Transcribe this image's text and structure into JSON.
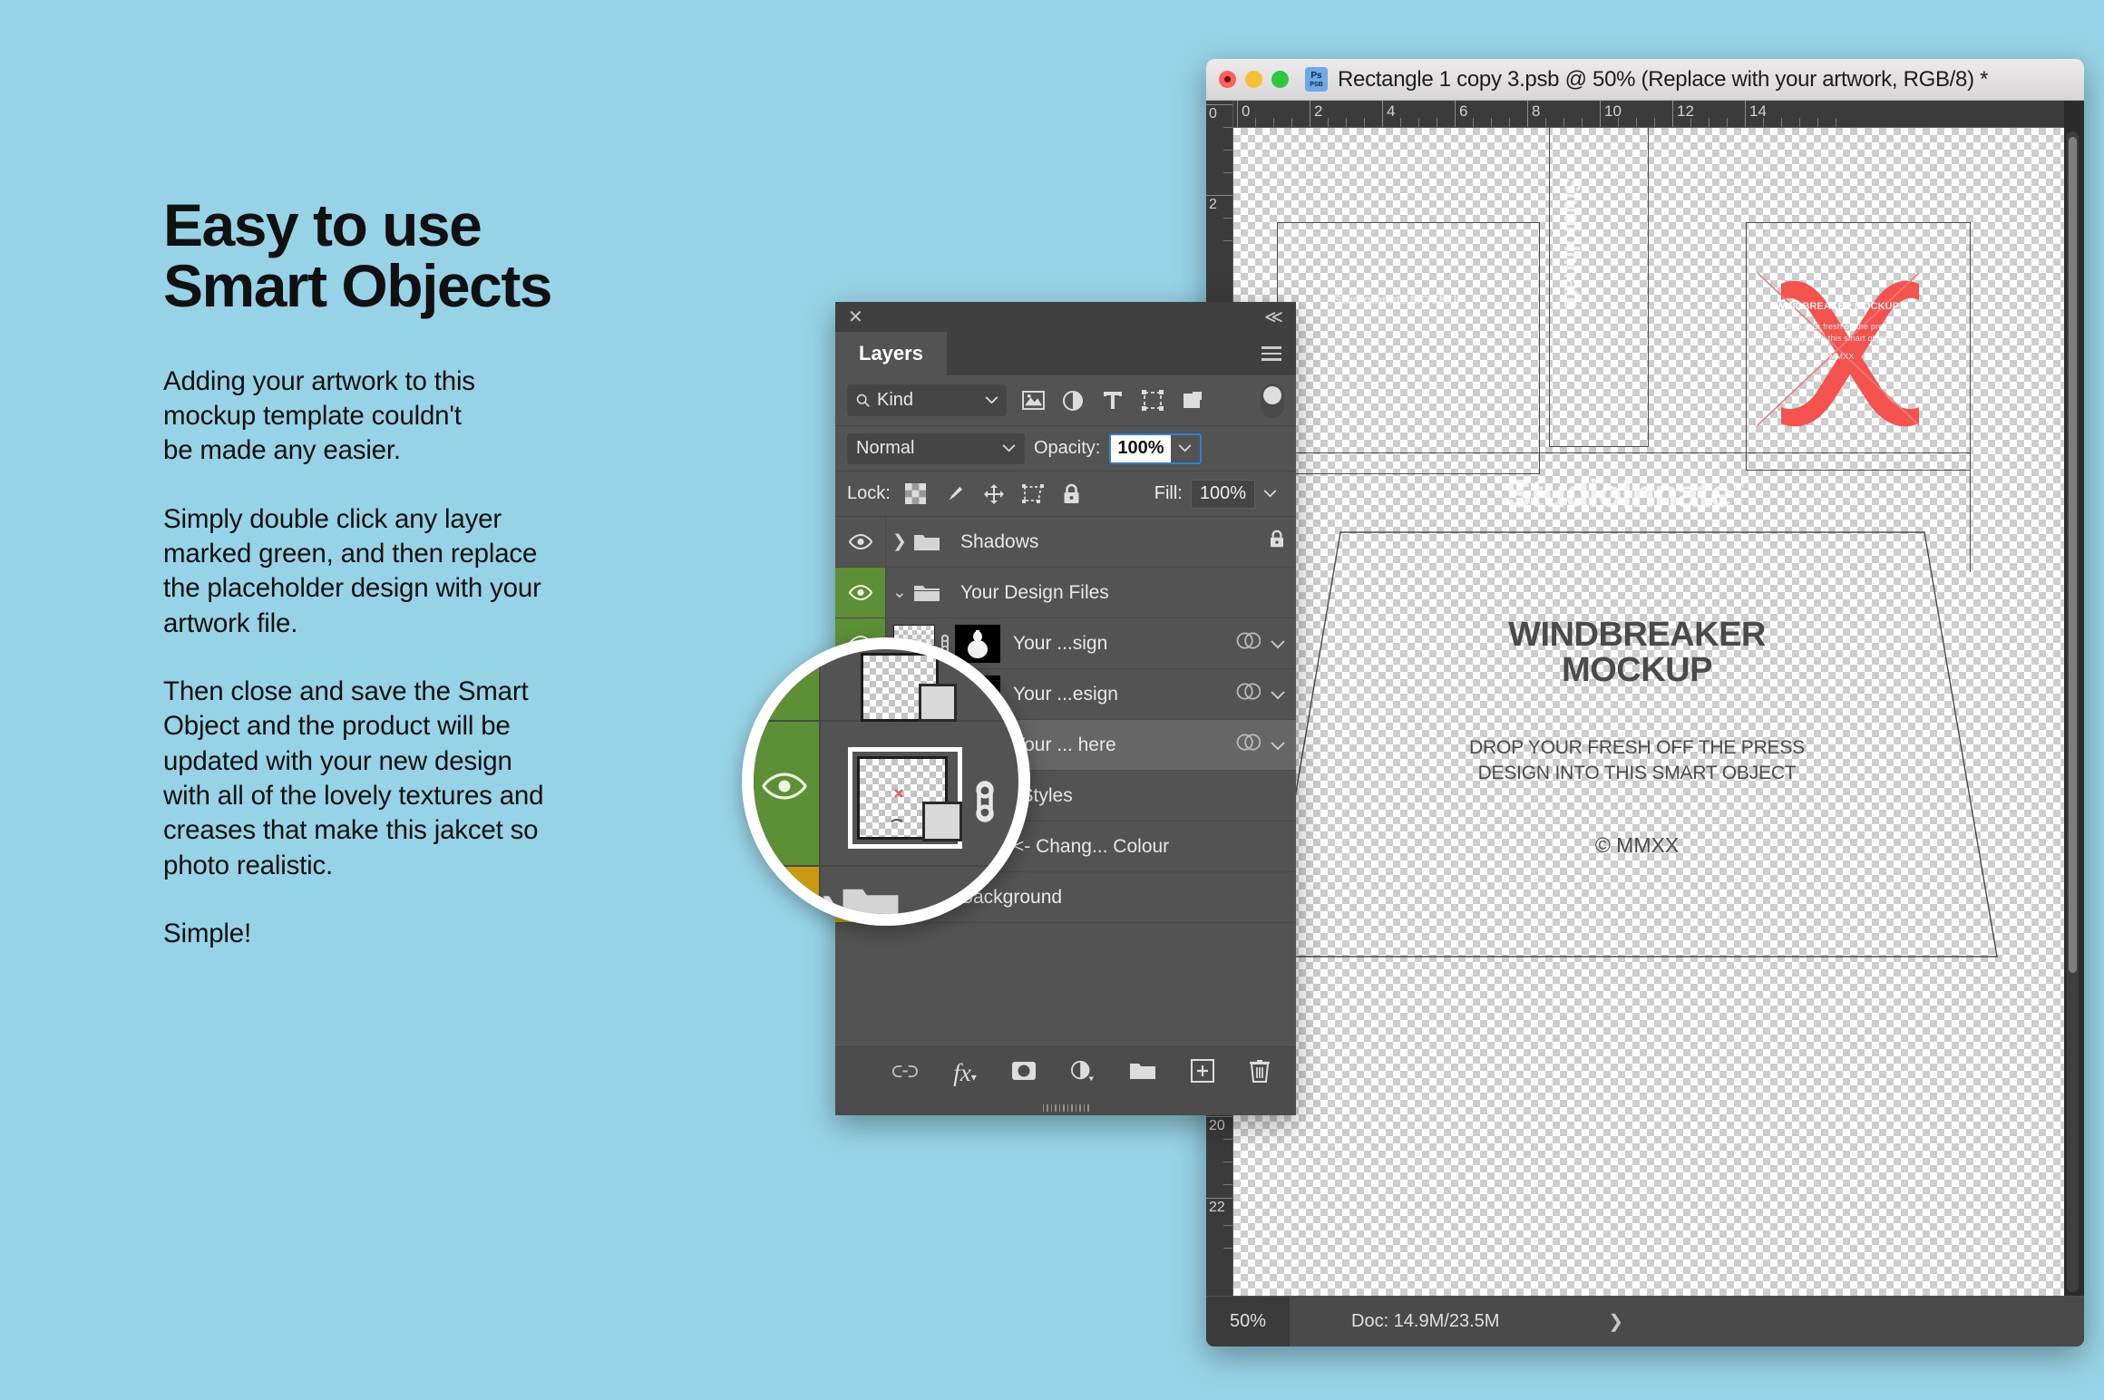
{
  "colors": {
    "background": "#97d3e6",
    "panel": "#535353",
    "accent_green": "#5d8f37",
    "accent_gold": "#c79a10",
    "highlight_blue": "#2f7fd4",
    "artwork_red": "#f4524d"
  },
  "promo": {
    "title": "Easy to use\nSmart Objects",
    "paragraphs": [
      "Adding your artwork to this\nmockup template couldn't\nbe made any easier.",
      "Simply double click any layer\nmarked green, and then replace\nthe placeholder design with your\nartwork file.",
      "Then close and save the Smart\nObject and the product will be\nupdated with your new design\nwith all of the lovely textures and\ncreases that make this jakcet so\nphoto realistic.",
      "Simple!"
    ]
  },
  "window": {
    "title": "Rectangle 1 copy 3.psb @ 50% (Replace with your artwork, RGB/8) *",
    "app_icon_top": "Ps",
    "app_icon_bottom": "PSB",
    "traffic_lights": [
      "close-button",
      "minimize-button",
      "maximize-button"
    ]
  },
  "rulers": {
    "horizontal_labels": [
      "0",
      "2",
      "4",
      "6",
      "8",
      "10",
      "12",
      "14"
    ],
    "vertical_labels": [
      "0",
      "2",
      "20",
      "22"
    ]
  },
  "canvas": {
    "watermark": "StudioInnate",
    "watermark_tm": "™",
    "watermark_vertical": "StudioInnate",
    "watermark_small": "StudioInnate\nMOCKUP",
    "artwork_overlay": {
      "heading": "WINDBREAKER MOCKUP",
      "line1": "Drop your fresh off the press",
      "line2": "design into this smart object",
      "copyright": "© MMXX"
    },
    "jacket": {
      "title": "WINDBREAKER\nMOCKUP",
      "subtitle": "DROP YOUR FRESH OFF THE PRESS\nDESIGN INTO THIS SMART OBJECT",
      "copyright": "© MMXX"
    }
  },
  "status_bar": {
    "zoom": "50%",
    "doc": "Doc: 14.9M/23.5M",
    "chevron": "❯"
  },
  "layers_panel": {
    "tab_label": "Layers",
    "close_label": "✕",
    "collapse_label": "≪",
    "filter": {
      "kind_label": "Kind",
      "icons": [
        "pixel-layer-filter-icon",
        "adjustment-layer-filter-icon",
        "type-layer-filter-icon",
        "shape-layer-filter-icon",
        "smart-object-filter-icon"
      ],
      "toggle_name": "filter-toggle"
    },
    "blend": {
      "mode": "Normal",
      "opacity_label": "Opacity:",
      "opacity_value": "100%"
    },
    "lock": {
      "label": "Lock:",
      "icons": [
        "lock-transparent-pixels-icon",
        "lock-image-pixels-icon",
        "lock-position-icon",
        "lock-artboard-nesting-icon",
        "lock-all-icon"
      ],
      "fill_label": "Fill:",
      "fill_value": "100%"
    },
    "rows": [
      {
        "name": "Shadows",
        "type": "group",
        "expanded": false,
        "eye": "on",
        "eye_color": "none",
        "locked": true
      },
      {
        "name": "Your Design Files",
        "type": "group",
        "expanded": true,
        "eye": "on",
        "eye_color": "green",
        "locked": false
      },
      {
        "name": "Your ...sign",
        "type": "smart",
        "eye": "on",
        "eye_color": "green",
        "selected": false
      },
      {
        "name": "Your ...esign",
        "type": "smart",
        "eye": "on",
        "eye_color": "green",
        "selected": false
      },
      {
        "name": "Your ... here",
        "type": "smart",
        "eye": "on",
        "eye_color": "green",
        "selected": true
      },
      {
        "name": "Jacket Styles",
        "type": "group",
        "expanded": false,
        "eye": "on",
        "eye_color": "none",
        "locked": false
      },
      {
        "name": "<- Chang... Colour",
        "type": "adjust",
        "eye": "on",
        "eye_color": "gold",
        "selected": false
      },
      {
        "name": "Background",
        "type": "group",
        "expanded": false,
        "eye": "off",
        "eye_color": "gold",
        "locked": false
      }
    ],
    "footer_icons": [
      "link-layers-icon",
      "layer-styles-fx-icon",
      "add-layer-mask-icon",
      "new-adjustment-layer-icon",
      "new-group-icon",
      "new-layer-icon",
      "delete-layer-icon"
    ],
    "footer_fx_label": "fx"
  }
}
